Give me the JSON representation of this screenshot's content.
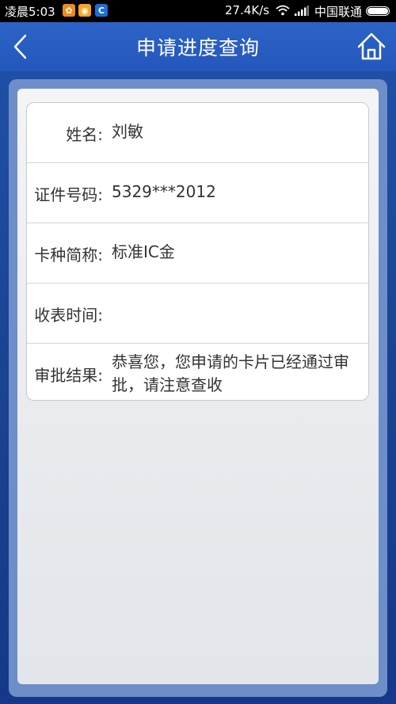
{
  "status_bar": {
    "time": "凌晨5:03",
    "speed": "27.4K/s",
    "carrier": "中国联通",
    "notification_icons": [
      "weibo-icon",
      "chat-icon",
      "browser-icon"
    ]
  },
  "header": {
    "title": "申请进度查询",
    "back_icon": "back-chevron-icon",
    "home_icon": "home-icon"
  },
  "info": {
    "rows": [
      {
        "label": "姓名:",
        "value": "刘敏"
      },
      {
        "label": "证件号码:",
        "value": "5329***2012"
      },
      {
        "label": "卡种简称:",
        "value": "标准IC金"
      },
      {
        "label": "收表时间:",
        "value": ""
      },
      {
        "label": "审批结果:",
        "value": "恭喜您，您申请的卡片已经通过审批，请注意查收"
      }
    ]
  },
  "colors": {
    "header_blue": "#2d63c8",
    "background_blue": "#1a4391",
    "card_border": "#c6c9ce"
  }
}
